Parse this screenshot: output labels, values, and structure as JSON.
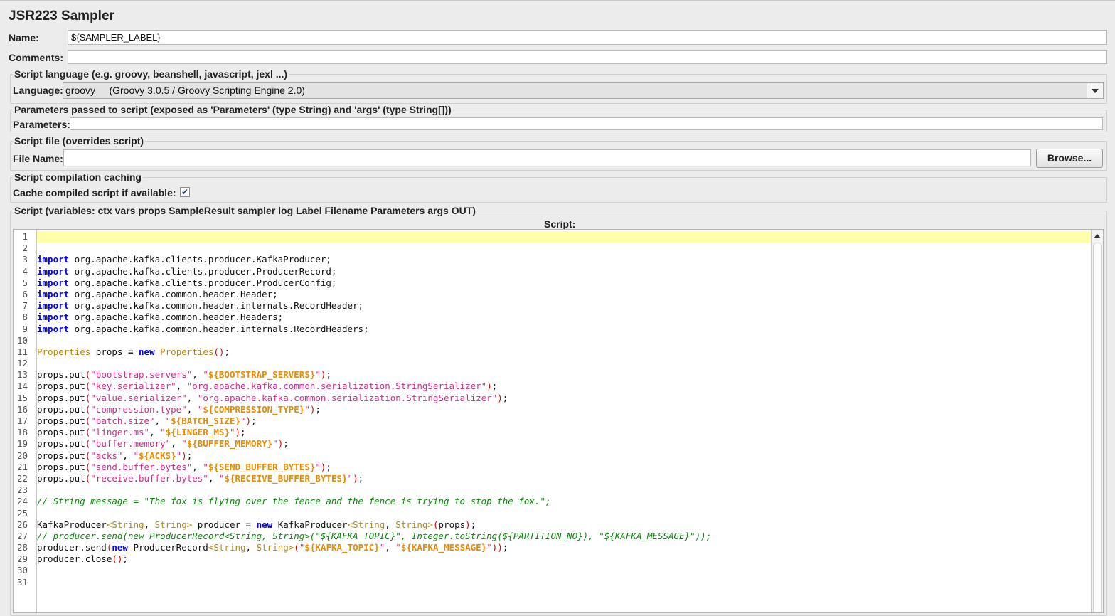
{
  "title": "JSR223 Sampler",
  "name": {
    "label": "Name:",
    "value": "${SAMPLER_LABEL}"
  },
  "comments": {
    "label": "Comments:",
    "value": ""
  },
  "script_language": {
    "legend": "Script language (e.g. groovy, beanshell, javascript, jexl ...)",
    "label": "Language:",
    "selected": "groovy     (Groovy 3.0.5 / Groovy Scripting Engine 2.0)"
  },
  "parameters": {
    "legend": "Parameters passed to script (exposed as 'Parameters' (type String) and 'args' (type String[]))",
    "label": "Parameters:",
    "value": ""
  },
  "script_file": {
    "legend": "Script file (overrides script)",
    "label": "File Name:",
    "value": "",
    "browse_label": "Browse..."
  },
  "caching": {
    "legend": "Script compilation caching",
    "label": "Cache compiled script if available:",
    "checked": true,
    "check_mark": "✔"
  },
  "script": {
    "legend": "Script (variables: ctx vars props SampleResult sampler log Label Filename Parameters args OUT)",
    "caption": "Script:",
    "lines": [
      "",
      "",
      "import org.apache.kafka.clients.producer.KafkaProducer;",
      "import org.apache.kafka.clients.producer.ProducerRecord;",
      "import org.apache.kafka.clients.producer.ProducerConfig;",
      "import org.apache.kafka.common.header.Header;",
      "import org.apache.kafka.common.header.internals.RecordHeader;",
      "import org.apache.kafka.common.header.Headers;",
      "import org.apache.kafka.common.header.internals.RecordHeaders;",
      "",
      "Properties props = new Properties();",
      "",
      "props.put(\"bootstrap.servers\", \"${BOOTSTRAP_SERVERS}\");",
      "props.put(\"key.serializer\", \"org.apache.kafka.common.serialization.StringSerializer\");",
      "props.put(\"value.serializer\", \"org.apache.kafka.common.serialization.StringSerializer\");",
      "props.put(\"compression.type\", \"${COMPRESSION_TYPE}\");",
      "props.put(\"batch.size\", \"${BATCH_SIZE}\");",
      "props.put(\"linger.ms\", \"${LINGER_MS}\");",
      "props.put(\"buffer.memory\", \"${BUFFER_MEMORY}\");",
      "props.put(\"acks\", \"${ACKS}\");",
      "props.put(\"send.buffer.bytes\", \"${SEND_BUFFER_BYTES}\");",
      "props.put(\"receive.buffer.bytes\", \"${RECEIVE_BUFFER_BYTES}\");",
      "",
      "// String message = \"The fox is flying over the fence and the fence is trying to stop the fox.\";",
      "",
      "KafkaProducer<String, String> producer = new KafkaProducer<String, String>(props);",
      "// producer.send(new ProducerRecord<String, String>(\"${KAFKA_TOPIC}\", Integer.toString(${PARTITION_NO}), \"${KAFKA_MESSAGE}\"));",
      "producer.send(new ProducerRecord<String, String>(\"${KAFKA_TOPIC}\", \"${KAFKA_MESSAGE}\"));",
      "producer.close();",
      "",
      ""
    ]
  }
}
